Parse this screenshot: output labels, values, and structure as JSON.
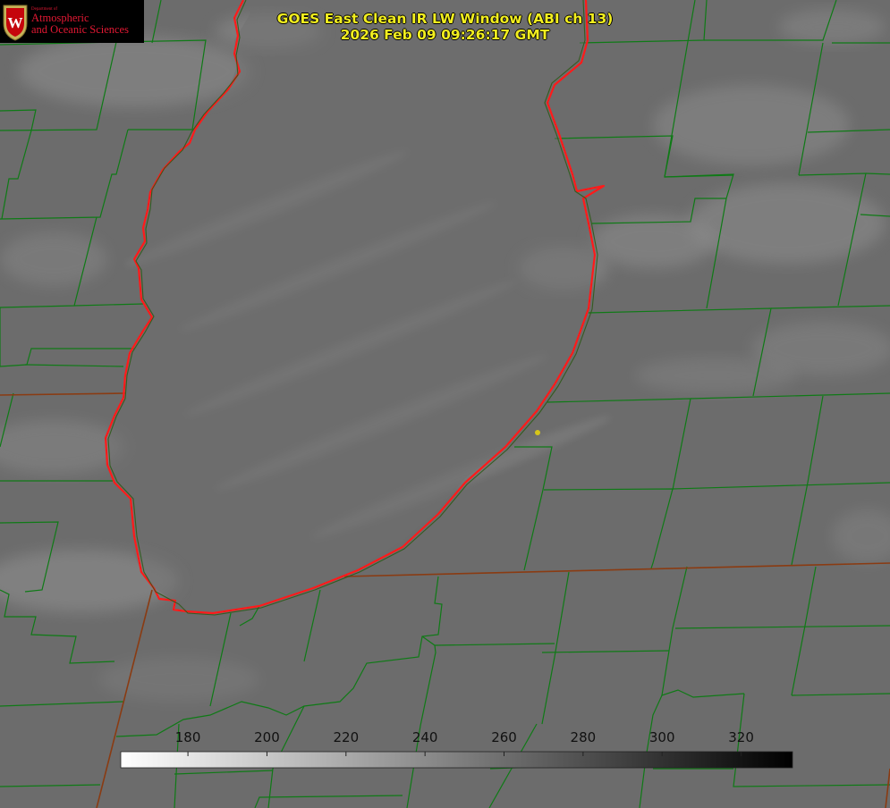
{
  "header": {
    "title": "GOES East Clean IR LW Window (ABI ch 13)",
    "timestamp": "2026 Feb 09 09:26:17 GMT"
  },
  "logo": {
    "department": "Department of",
    "line1": "Atmospheric",
    "line2": "and Oceanic Sciences",
    "seal_letter": "W"
  },
  "colorbar": {
    "ticks": [
      180,
      200,
      220,
      240,
      260,
      280,
      300,
      320
    ],
    "range": [
      163,
      333
    ],
    "gradient": [
      "#ffffff",
      "#000000"
    ]
  },
  "colors": {
    "county_lines": "#0f7a16",
    "state_lines": "#8a3b12",
    "lake_outline": "#ff1a1a",
    "title_text": "#f2ee1f",
    "marker": "#d6c619",
    "logo_red": "#e21833",
    "background": "#6e6e6e"
  }
}
